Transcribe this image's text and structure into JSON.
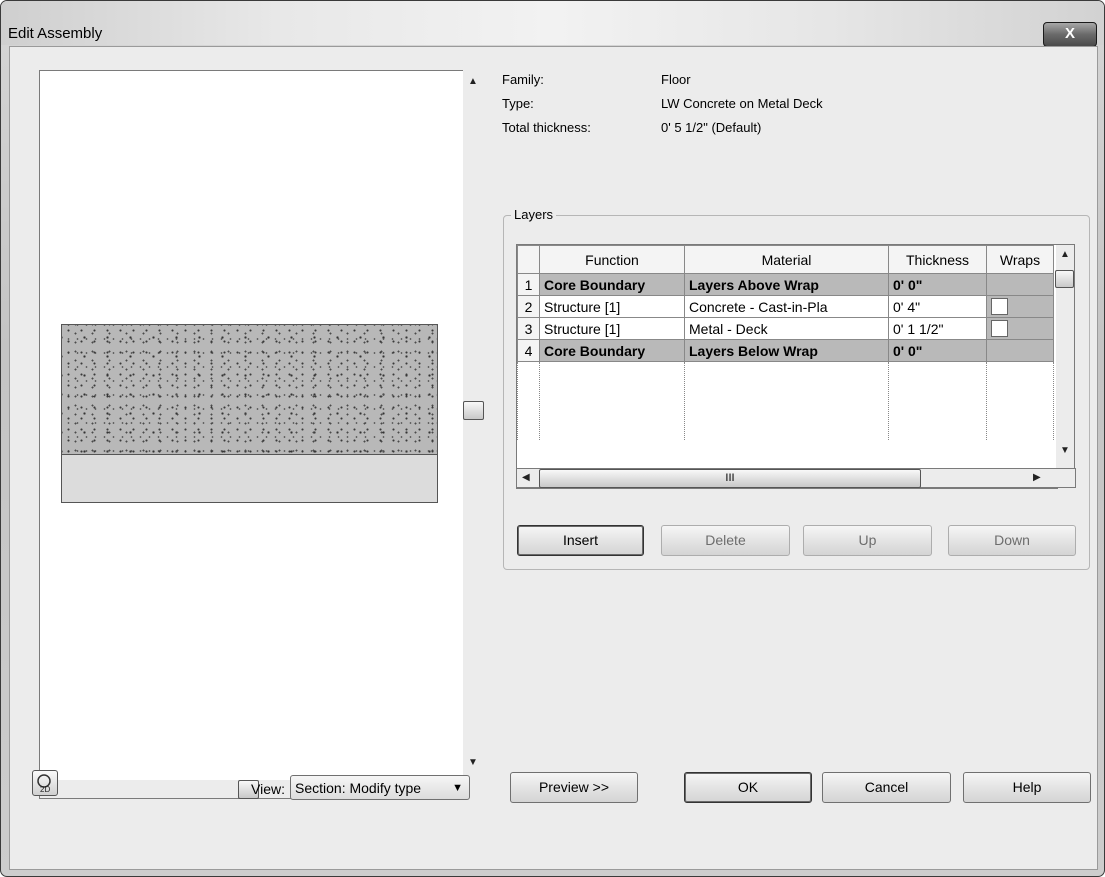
{
  "window": {
    "title": "Edit Assembly",
    "close_glyph": "X"
  },
  "properties": [
    {
      "label": "Family:",
      "value": "Floor"
    },
    {
      "label": "Type:",
      "value": "LW Concrete on Metal Deck"
    },
    {
      "label": "Total thickness:",
      "value": "0'  5 1/2\" (Default)"
    }
  ],
  "layers": {
    "legend": "Layers",
    "columns": [
      "",
      "Function",
      "Material",
      "Thickness",
      "Wraps"
    ],
    "rows": [
      {
        "num": "1",
        "function": "Core Boundary",
        "material": "Layers Above Wrap",
        "thickness": "0'  0\"",
        "wraps": null
      },
      {
        "num": "2",
        "function": "Structure [1]",
        "material": "Concrete - Cast-in-Pla",
        "thickness": "0'  4\"",
        "wraps": false
      },
      {
        "num": "3",
        "function": "Structure [1]",
        "material": "Metal - Deck",
        "thickness": "0'  1 1/2\"",
        "wraps": false
      },
      {
        "num": "4",
        "function": "Core Boundary",
        "material": "Layers Below Wrap",
        "thickness": "0'  0\"",
        "wraps": null
      }
    ],
    "scroll_thumb_glyph": "III"
  },
  "layer_buttons": {
    "insert": "Insert",
    "delete": "Delete",
    "up": "Up",
    "down": "Down"
  },
  "bottom": {
    "view_label": "View:",
    "view_value": "Section: Modify type",
    "preview": "Preview >>",
    "ok": "OK",
    "cancel": "Cancel",
    "help": "Help"
  },
  "icons": [
    "close-icon",
    "scroll-up-icon",
    "scroll-down-icon",
    "scroll-left-icon",
    "scroll-right-icon",
    "view-2d-icon",
    "dropdown-caret-icon"
  ]
}
